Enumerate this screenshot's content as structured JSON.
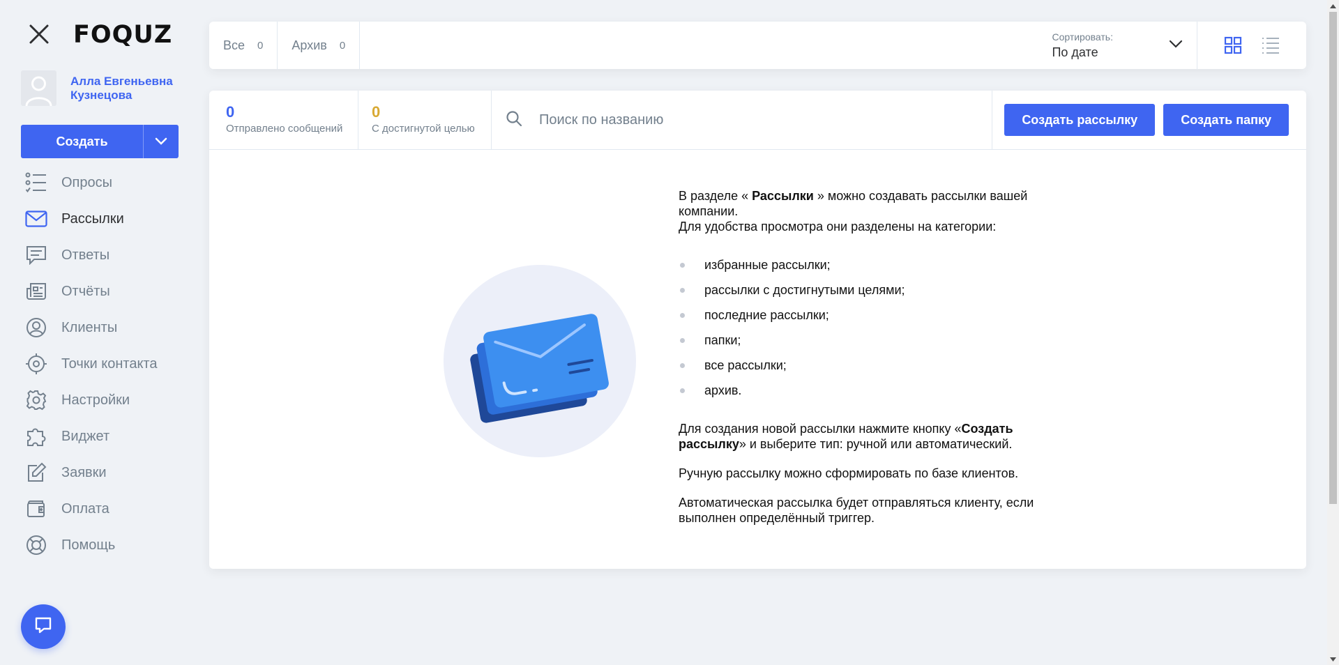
{
  "app": {
    "logo": "FOQUZ"
  },
  "user": {
    "name": "Алла Евгеньевна Кузнецова"
  },
  "sidebar": {
    "create_label": "Создать",
    "items": [
      {
        "label": "Опросы",
        "icon": "list-check-icon"
      },
      {
        "label": "Рассылки",
        "icon": "envelope-icon",
        "active": true
      },
      {
        "label": "Ответы",
        "icon": "message-lines-icon"
      },
      {
        "label": "Отчёты",
        "icon": "newspaper-icon"
      },
      {
        "label": "Клиенты",
        "icon": "user-circle-icon"
      },
      {
        "label": "Точки контакта",
        "icon": "crosshair-icon"
      },
      {
        "label": "Настройки",
        "icon": "gear-icon"
      },
      {
        "label": "Виджет",
        "icon": "puzzle-icon"
      },
      {
        "label": "Заявки",
        "icon": "edit-square-icon"
      },
      {
        "label": "Оплата",
        "icon": "wallet-icon"
      },
      {
        "label": "Помощь",
        "icon": "lifebuoy-icon"
      }
    ]
  },
  "topbar": {
    "tabs": [
      {
        "label": "Все",
        "count": "0"
      },
      {
        "label": "Архив",
        "count": "0"
      }
    ],
    "sort_label": "Сортировать:",
    "sort_value": "По дате"
  },
  "stats": {
    "sent_value": "0",
    "sent_label": "Отправлено сообщений",
    "goal_value": "0",
    "goal_label": "С достигнутой целью"
  },
  "search": {
    "placeholder": "Поиск по названию"
  },
  "actions": {
    "create_mailing": "Создать рассылку",
    "create_folder": "Создать папку"
  },
  "info": {
    "intro_prefix": "В разделе « ",
    "intro_bold": "Рассылки",
    "intro_suffix": " » можно создавать рассылки вашей компании.",
    "intro_line2": "Для удобства просмотра они разделены на категории:",
    "categories": [
      "избранные рассылки;",
      "рассылки с достигнутыми целями;",
      "последние рассылки;",
      "папки;",
      "все рассылки;",
      "архив."
    ],
    "create_prefix": "Для создания новой рассылки нажмите кнопку «",
    "create_bold": "Создать рассылку",
    "create_suffix": "» и выберите тип: ручной или автоматический.",
    "manual": "Ручную рассылку можно сформировать по базе клиентов.",
    "auto": "Автоматическая рассылка будет отправляться клиенту, если выполнен определённый триггер."
  },
  "colors": {
    "accent": "#3f65f1",
    "gold": "#d8a933",
    "muted": "#73808d",
    "background": "#eff2f6"
  }
}
